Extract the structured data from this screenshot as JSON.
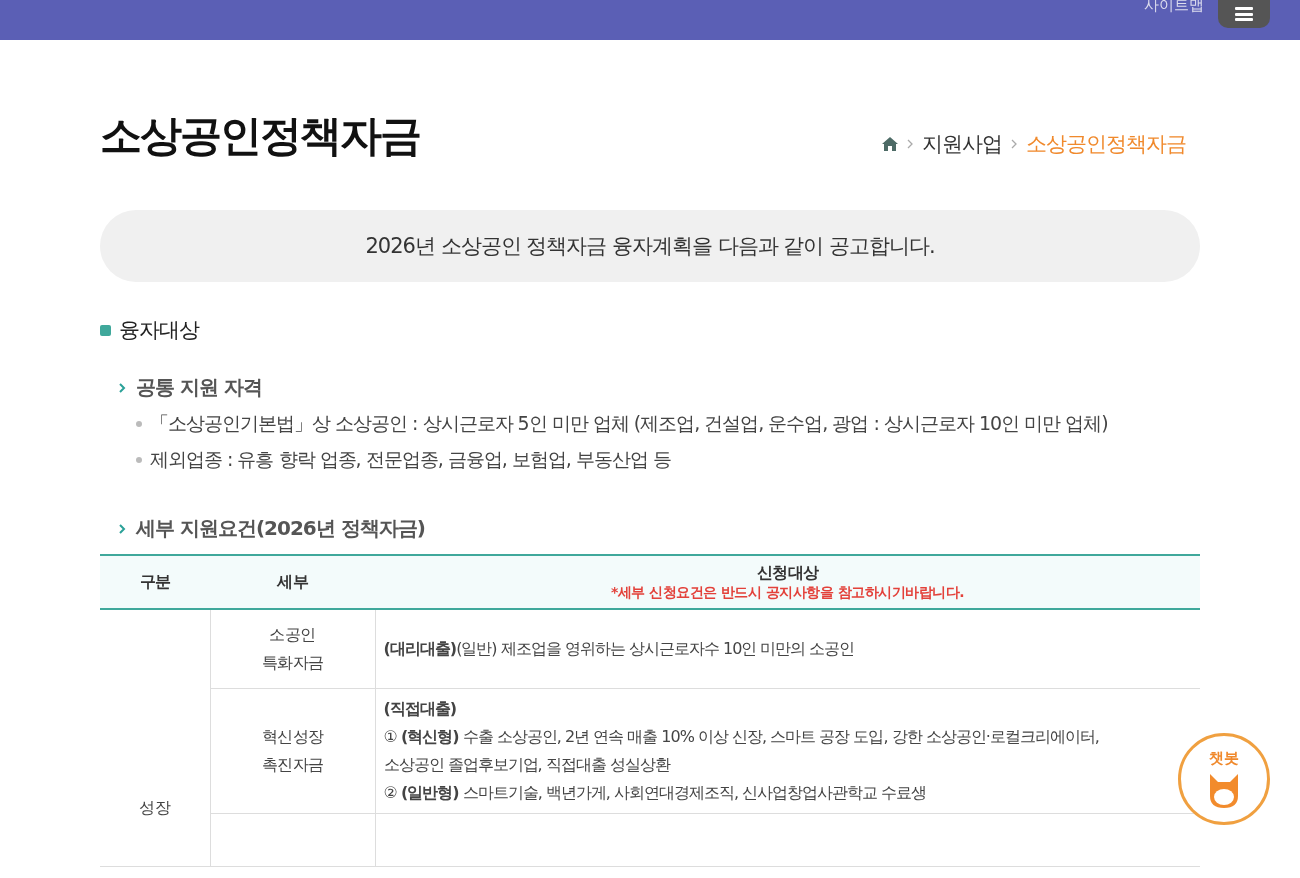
{
  "header": {
    "sitemap_link": "사이트맵"
  },
  "page_title": "소상공인정책자금",
  "breadcrumb": [
    {
      "label": "지원사업",
      "current": false
    },
    {
      "label": "소상공인정책자금",
      "current": true
    }
  ],
  "notice": "2026년 소상공인 정책자금 융자계획을 다음과 같이 공고합니다.",
  "section": {
    "heading": "융자대상",
    "subsections": [
      {
        "heading": "공통 지원 자격",
        "bullets": [
          "「소상공인기본법」상 소상공인 : 상시근로자 5인 미만 업체 (제조업, 건설업, 운수업, 광업 : 상시근로자 10인 미만 업체)",
          "제외업종 : 유흥 향락 업종, 전문업종, 금융업, 보험업, 부동산업 등"
        ]
      },
      {
        "heading": "세부 지원요건(2026년 정책자금)"
      }
    ]
  },
  "table": {
    "columns": [
      "구분",
      "세부",
      "신청대상"
    ],
    "header_note": "*세부 신청요건은 반드시 공지사항을 참고하시기바랍니다.",
    "group": "성장",
    "rows": [
      {
        "kind": "text",
        "detail": [
          "소공인",
          "특화자금"
        ],
        "target": [
          "**(대리대출)**(일반) 제조업을 영위하는 상시근로자수 10인 미만의 소공인"
        ]
      },
      {
        "kind": "text",
        "detail": [
          "혁신성장",
          "촉진자금"
        ],
        "target": [
          "**(직접대출)**",
          "① **(혁신형)** 수출 소상공인, 2년 연속 매출 10% 이상 신장, 스마트 공장 도입, 강한 소상공인·로컬크리에이터, 소상공인 졸업후보기업, 직접대출 성실상환",
          "② **(일반형)** 스마트기술, 백년가게, 사회연대경제조직, 신사업창업사관학교 수료생"
        ]
      },
      {
        "kind": "empty"
      }
    ]
  },
  "chatbot": {
    "label": "챗봇"
  }
}
